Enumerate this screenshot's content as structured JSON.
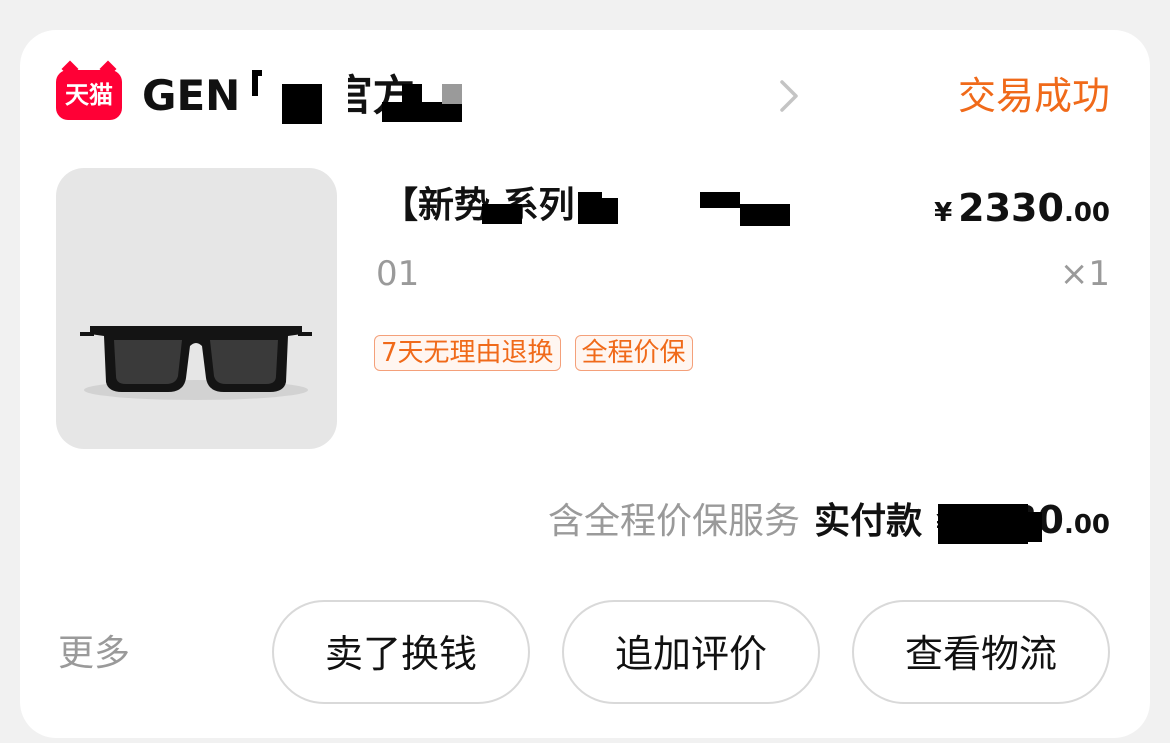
{
  "shop": {
    "platform_logo_text": "天猫",
    "name": "GEN                  ER 官方...",
    "status": "交易成功"
  },
  "product": {
    "title": "【新势          系列...",
    "price_currency": "¥",
    "price_integer": "2330",
    "price_decimal": ".00",
    "sku": "01",
    "quantity": "×1",
    "tags": [
      "7天无理由退换",
      "全程价保"
    ],
    "image_icon": "sunglasses-image"
  },
  "payment": {
    "service_note": "含全程价保服务",
    "paid_label": "实付款",
    "currency": "¥",
    "amount_integer": "2330",
    "amount_decimal": ".00"
  },
  "actions": {
    "more_label": "更多",
    "sell_label": "卖了换钱",
    "review_label": "追加评价",
    "logistics_label": "查看物流"
  },
  "colors": {
    "accent": "#f06a1a",
    "tmall_red": "#ff0036"
  }
}
